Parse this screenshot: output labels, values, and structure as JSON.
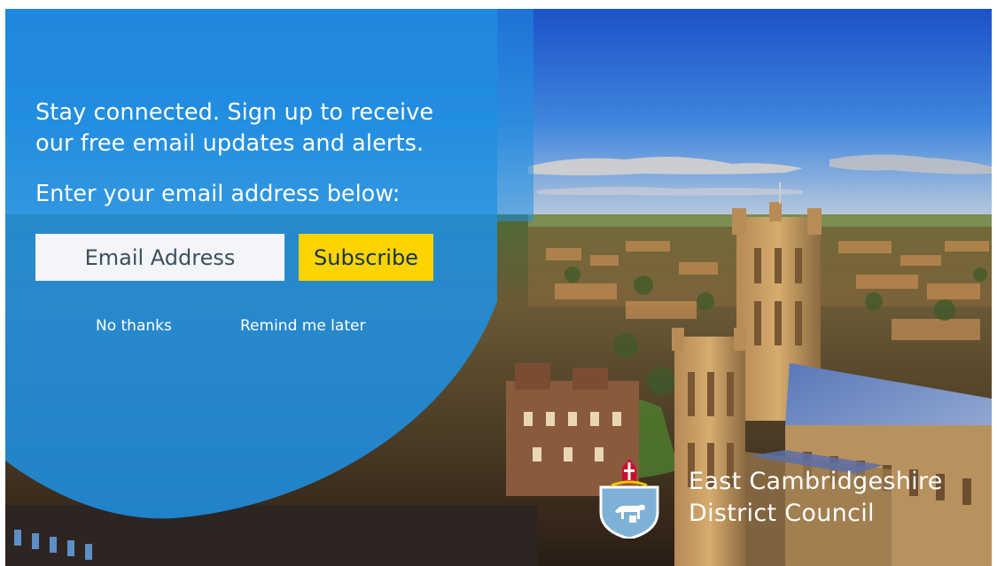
{
  "signup": {
    "headline": "Stay connected. Sign up to receive\nour free email updates and alerts.",
    "prompt": "Enter your email address below:",
    "email_placeholder": "Email Address",
    "email_value": "",
    "subscribe_label": "Subscribe",
    "no_thanks_label": "No thanks",
    "remind_label": "Remind me later"
  },
  "brand": {
    "name": "East Cambridgeshire\nDistrict Council",
    "logo_icon": "council-crest-icon"
  },
  "colors": {
    "panel_blue": "#1f8fe0",
    "subscribe_yellow": "#fdd300",
    "input_bg": "#f3f5f8",
    "text_dark": "#163447",
    "shield_blue": "#7fb1d6"
  }
}
